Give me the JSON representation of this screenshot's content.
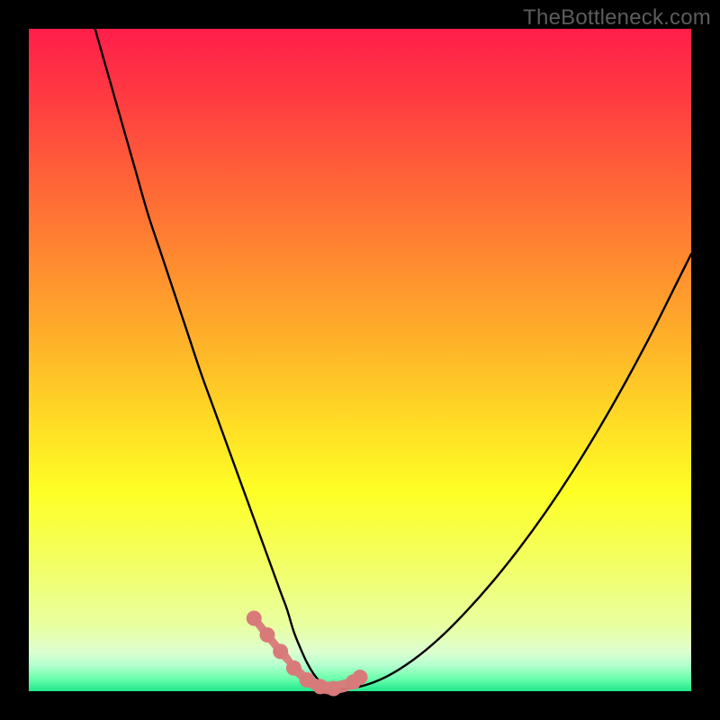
{
  "watermark": "TheBottleneck.com",
  "colors": {
    "gradient_top": "#ff1e4a",
    "gradient_bottom": "#20e78a",
    "curve": "#000000",
    "marker": "#d97a7a",
    "frame_bg": "#000000"
  },
  "chart_data": {
    "type": "line",
    "title": "",
    "xlabel": "",
    "ylabel": "",
    "xlim": [
      0,
      100
    ],
    "ylim": [
      0,
      100
    ],
    "grid": false,
    "legend": false,
    "x": [
      10,
      12,
      14,
      16,
      18,
      20,
      22,
      24,
      26,
      28,
      30,
      32,
      34,
      36,
      38,
      39,
      40,
      41,
      42,
      43,
      44,
      45,
      46,
      50,
      54,
      58,
      62,
      66,
      70,
      74,
      78,
      82,
      86,
      90,
      94,
      98,
      100
    ],
    "values": [
      100,
      93,
      86,
      79,
      72,
      66,
      60,
      54,
      48,
      42.5,
      37,
      31.5,
      26,
      20.5,
      15,
      12.3,
      9,
      6.5,
      4.3,
      2.6,
      1.4,
      0.7,
      0.3,
      0.7,
      2.2,
      4.7,
      8,
      12,
      16.5,
      21.5,
      27,
      33,
      39.5,
      46.5,
      54,
      62,
      66
    ],
    "markers_x": [
      34,
      36,
      38,
      39,
      40,
      41,
      42,
      43,
      44,
      45,
      46,
      48,
      49,
      50
    ],
    "markers_values": [
      11,
      8.5,
      6,
      5,
      3.5,
      2.6,
      1.7,
      1.1,
      0.7,
      0.5,
      0.4,
      0.9,
      1.4,
      2.1
    ]
  }
}
